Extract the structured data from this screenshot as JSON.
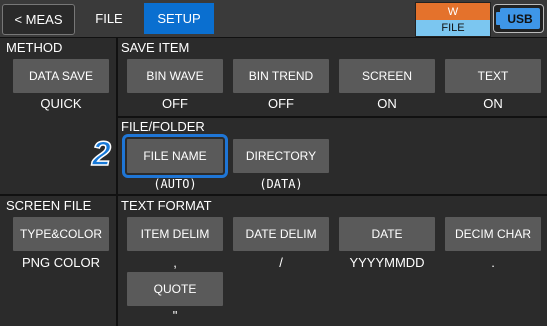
{
  "tabs": {
    "meas": "< MEAS",
    "file": "FILE",
    "setup": "SETUP"
  },
  "status": {
    "w_label": "W",
    "file_label": "FILE",
    "usb_label": "USB"
  },
  "method": {
    "title": "METHOD",
    "button": "DATA SAVE",
    "value": "QUICK"
  },
  "save_item": {
    "title": "SAVE ITEM",
    "items": [
      {
        "label": "BIN WAVE",
        "value": "OFF"
      },
      {
        "label": "BIN TREND",
        "value": "OFF"
      },
      {
        "label": "SCREEN",
        "value": "ON"
      },
      {
        "label": "TEXT",
        "value": "ON"
      }
    ]
  },
  "file_folder": {
    "title": "FILE/FOLDER",
    "step_badge": "2",
    "file_name": {
      "label": "FILE NAME",
      "value": "(AUTO)"
    },
    "directory": {
      "label": "DIRECTORY",
      "value": "(DATA)"
    }
  },
  "screen_file": {
    "title": "SCREEN FILE",
    "button": "TYPE&COLOR",
    "value": "PNG COLOR"
  },
  "text_format": {
    "title": "TEXT FORMAT",
    "items": [
      {
        "label": "ITEM DELIM",
        "value": ","
      },
      {
        "label": "DATE DELIM",
        "value": "/"
      },
      {
        "label": "DATE",
        "value": "YYYYMMDD"
      },
      {
        "label": "DECIM CHAR",
        "value": "."
      }
    ],
    "quote": {
      "label": "QUOTE",
      "value": "\""
    }
  },
  "colors": {
    "accent": "#0a6fd0",
    "panel": "#2b2b2b",
    "button": "#5a5a5a",
    "w_indicator": "#e4722c",
    "file_indicator": "#7bc6f0"
  }
}
